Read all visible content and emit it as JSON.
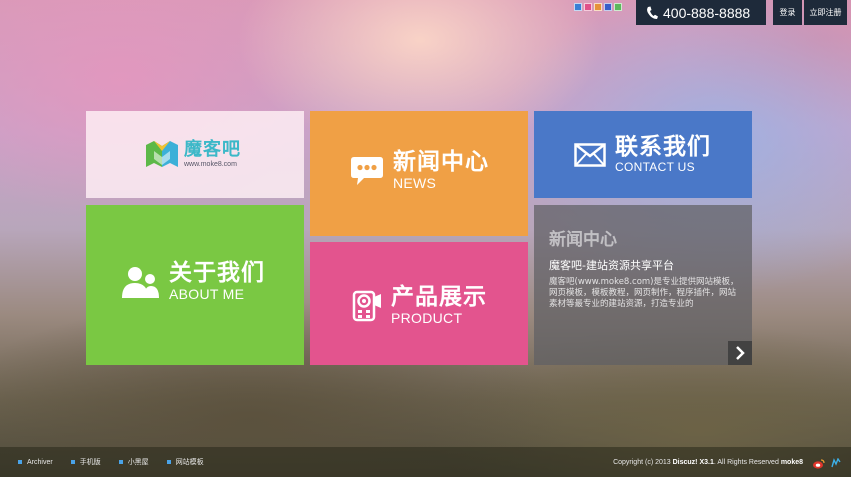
{
  "header": {
    "phone": "400-888-8888",
    "login_label": "登录",
    "register_label": "立即注册",
    "theme_swatches": [
      "#3a7fd5",
      "#e0508a",
      "#e6923a",
      "#3a5ec8",
      "#5cb85c"
    ]
  },
  "tiles": {
    "logo": {
      "name": "魔客吧",
      "url": "www.moke8.com"
    },
    "about": {
      "title": "关于我们",
      "subtitle": "ABOUT ME",
      "icon": "users-icon"
    },
    "news": {
      "title": "新闻中心",
      "subtitle": "NEWS",
      "icon": "chat-bubble-icon"
    },
    "product": {
      "title": "产品展示",
      "subtitle": "PRODUCT",
      "icon": "camera-icon"
    },
    "contact": {
      "title": "联系我们",
      "subtitle": "CONTACT US",
      "icon": "envelope-icon"
    },
    "info": {
      "title": "新闻中心",
      "subtitle": "魔客吧-建站资源共享平台",
      "description": "魔客吧(www.moke8.com)是专业提供网站模板，网页模板，模板教程，网页制作，程序插件，网站素材等最专业的建站资源，打造专业的",
      "arrow_icon": "chevron-right-icon"
    }
  },
  "footer": {
    "links": [
      "Archiver",
      "手机版",
      "小黑屋",
      "网站模板"
    ],
    "copyright_prefix": "Copyright (c) 2013",
    "brand": "Discuz! X3.1",
    "rights": ". All Rights Reserved",
    "owner": "moke8",
    "icons": [
      "weibo-icon",
      "qq-icon"
    ]
  },
  "colors": {
    "about": "#7ac843",
    "news": "#f0a045",
    "product": "#e3548e",
    "contact": "#4a78c8",
    "topbar": "#1e2a3a"
  }
}
